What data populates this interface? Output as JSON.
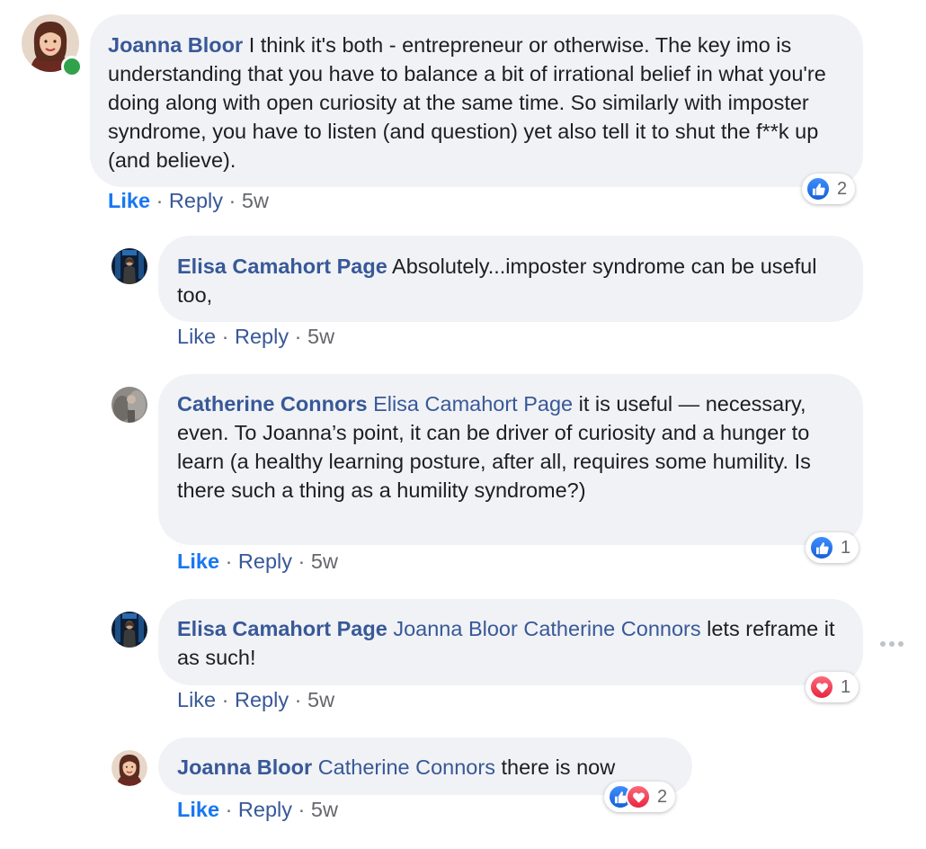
{
  "comments": [
    {
      "author": "Joanna Bloor",
      "mentions": [],
      "text": "I think it's both - entrepreneur or otherwise. The key imo is understanding that you have to balance a bit of irrational belief in what you're doing along with open curiosity at the same time. So similarly with imposter syndrome, you have to listen (and question) yet also tell it to shut the f**k up (and believe).",
      "like_label": "Like",
      "reply_label": "Reply",
      "time": "5w",
      "reaction_count": "2",
      "online": true
    },
    {
      "author": "Elisa Camahort Page",
      "mentions": [],
      "text": "Absolutely...imposter syndrome can be useful too,",
      "like_label": "Like",
      "reply_label": "Reply",
      "time": "5w"
    },
    {
      "author": "Catherine Connors",
      "mentions": [
        "Elisa Camahort Page"
      ],
      "text": "it is useful — necessary, even. To Joanna’s point, it can be driver of curiosity and a hunger to learn (a healthy learning posture, after all, requires some humility. Is there such a thing as a humility syndrome?)",
      "like_label": "Like",
      "reply_label": "Reply",
      "time": "5w",
      "reaction_count": "1"
    },
    {
      "author": "Elisa Camahort Page",
      "mentions": [
        "Joanna Bloor",
        "Catherine Connors"
      ],
      "text": "lets reframe it as such!",
      "like_label": "Like",
      "reply_label": "Reply",
      "time": "5w",
      "reaction_count": "1"
    },
    {
      "author": "Joanna Bloor",
      "mentions": [
        "Catherine Connors"
      ],
      "text": "there is now",
      "like_label": "Like",
      "reply_label": "Reply",
      "time": "5w",
      "reaction_count": "2"
    }
  ],
  "separator": "·",
  "icons": {
    "like": "thumbs-up-icon",
    "love": "heart-icon",
    "more": "more-options-icon"
  },
  "colors": {
    "author": "#385898",
    "liked": "#1877f2",
    "bubble": "#f0f2f5",
    "muted": "#65676b",
    "online": "#31a24c"
  }
}
